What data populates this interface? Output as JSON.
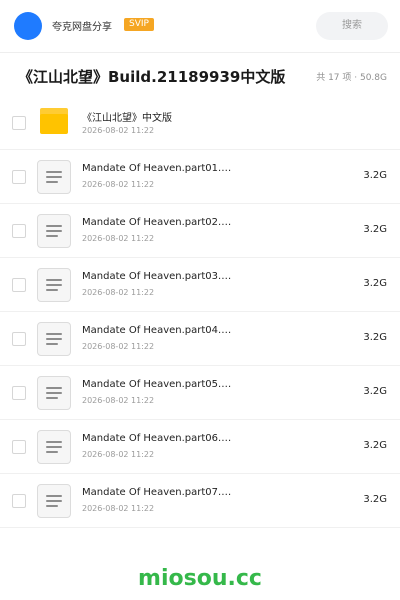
{
  "header": {
    "share_name": "夸克网盘分享",
    "badge": "SVIP",
    "search_label": "搜索",
    "accent_color": "#1f7bff"
  },
  "folder": {
    "title": "《江山北望》Build.21189939中文版",
    "summary": "共 17 项 · 50.8G"
  },
  "items": [
    {
      "type": "folder",
      "name": "《江山北望》中文版",
      "date": "2026-08-02 11:22",
      "size": ""
    },
    {
      "type": "file",
      "name": "Mandate Of Heaven.part01.…",
      "date": "2026-08-02 11:22",
      "size": "3.2G"
    },
    {
      "type": "file",
      "name": "Mandate Of Heaven.part02.…",
      "date": "2026-08-02 11:22",
      "size": "3.2G"
    },
    {
      "type": "file",
      "name": "Mandate Of Heaven.part03.…",
      "date": "2026-08-02 11:22",
      "size": "3.2G"
    },
    {
      "type": "file",
      "name": "Mandate Of Heaven.part04.…",
      "date": "2026-08-02 11:22",
      "size": "3.2G"
    },
    {
      "type": "file",
      "name": "Mandate Of Heaven.part05.…",
      "date": "2026-08-02 11:22",
      "size": "3.2G"
    },
    {
      "type": "file",
      "name": "Mandate Of Heaven.part06.…",
      "date": "2026-08-02 11:22",
      "size": "3.2G"
    },
    {
      "type": "file",
      "name": "Mandate Of Heaven.part07.…",
      "date": "2026-08-02 11:22",
      "size": "3.2G"
    }
  ],
  "watermark": "miosou.cc",
  "watermark_color": "#35b84a",
  "folder_color": "#ffc300"
}
